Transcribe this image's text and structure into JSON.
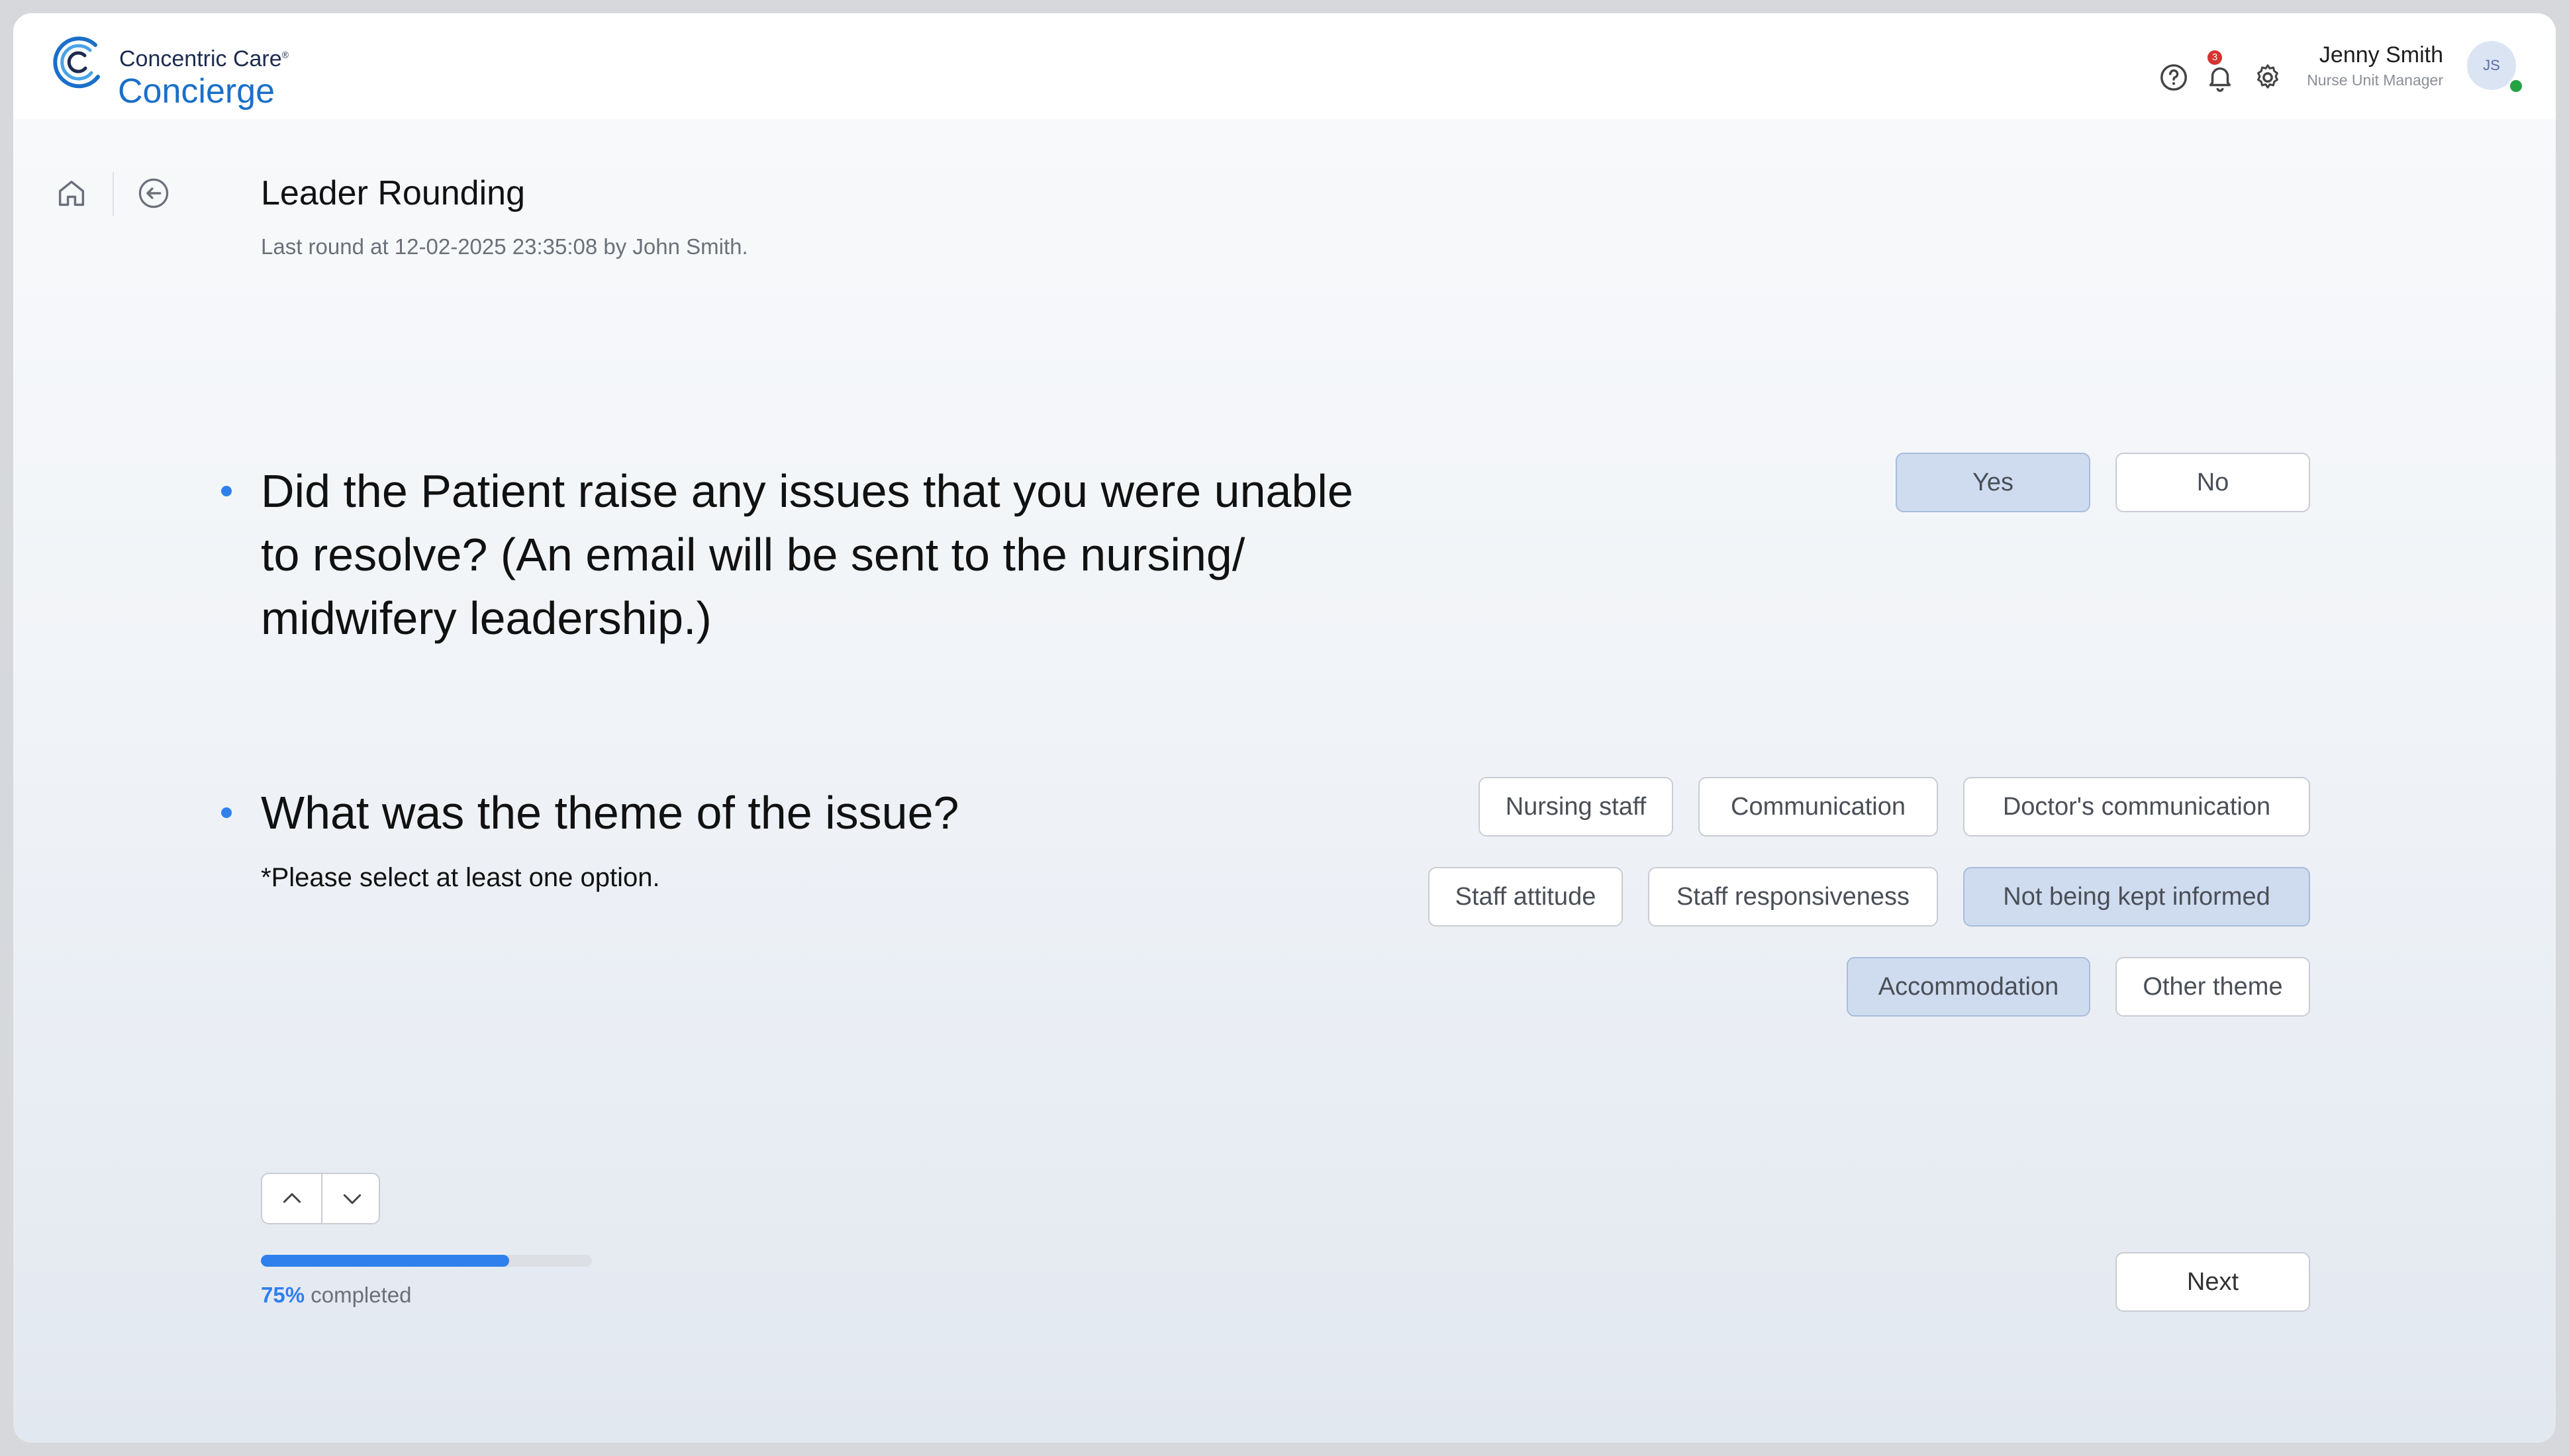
{
  "brand": {
    "small": "Concentric Care",
    "mark": "®",
    "big": "Concierge",
    "accent": "#1b6fc8"
  },
  "header": {
    "icons": [
      "help-circle-icon",
      "bell-icon",
      "gear-icon"
    ],
    "notification_count": "3",
    "user_name": "Jenny Smith",
    "user_role": "Nurse Unit Manager",
    "avatar_initials": "JS",
    "status_color": "#25a244"
  },
  "page": {
    "title": "Leader Rounding",
    "subtitle": "Last round at 12-02-2025 23:35:08 by John Smith."
  },
  "q1": {
    "text": "Did the Patient raise any issues that you were unable to resolve? (An email will be sent to the nursing/ midwifery leadership.)",
    "options": [
      {
        "label": "Yes",
        "selected": true
      },
      {
        "label": "No",
        "selected": false
      }
    ]
  },
  "q2": {
    "text": "What was the theme of the issue?",
    "note": "*Please select at least one option.",
    "options": [
      {
        "label": "Nursing staff",
        "selected": false
      },
      {
        "label": "Communication",
        "selected": false
      },
      {
        "label": "Doctor's communication",
        "selected": false
      },
      {
        "label": "Staff attitude",
        "selected": false
      },
      {
        "label": "Staff responsiveness",
        "selected": false
      },
      {
        "label": "Not being kept informed",
        "selected": true
      },
      {
        "label": "Accommodation",
        "selected": true
      },
      {
        "label": "Other theme",
        "selected": false
      }
    ]
  },
  "progress": {
    "percent": 75,
    "percent_label": "75%",
    "suffix": "completed"
  },
  "footer": {
    "next_label": "Next"
  },
  "colors": {
    "selected_bg": "#cfdcef",
    "progress": "#2f80ed"
  }
}
